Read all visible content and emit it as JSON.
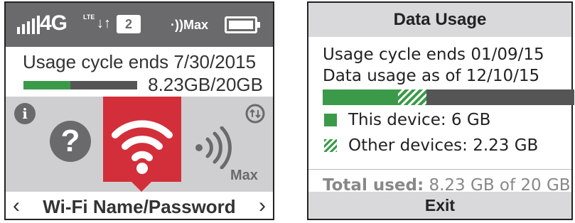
{
  "left": {
    "status": {
      "network": "4G",
      "network_sub": "LTE",
      "message_count": "2",
      "wifi_range": "Max",
      "battery_level": 1.0
    },
    "usage_cycle": "Usage cycle ends 7/30/2015",
    "usage_amount": "8.23GB/20GB",
    "usage_fraction": 0.41,
    "tiles": {
      "range_label": "Max"
    },
    "nav": {
      "title": "Wi-Fi Name/Password",
      "prev": "‹",
      "next": "›"
    }
  },
  "right": {
    "header": "Data Usage",
    "cycle_line": "Usage cycle ends 01/09/15",
    "as_of_line": "Data usage as of 12/10/15",
    "usage": {
      "this_device_gb": 6,
      "other_devices_gb": 2.23,
      "plan_gb": 20
    },
    "legend": {
      "this_device": "This device: 6 GB",
      "other_devices": "Other devices: 2.23 GB"
    },
    "total": {
      "label": "Total used:",
      "value": "8.23 GB of 20 GB"
    },
    "exit_label": "Exit"
  },
  "colors": {
    "status_bar": "#6a6a6c",
    "accent_red": "#d32f3a",
    "usage_green": "#3b9a4a",
    "bar_gray": "#555555",
    "panel_gray": "#cfcfd1"
  },
  "icons": [
    "signal-icon",
    "transfer-arrows-icon",
    "message-badge-icon",
    "wifi-range-icon",
    "battery-icon",
    "info-icon",
    "help-icon",
    "wifi-icon",
    "range-icon",
    "toggle-icon",
    "chevron-left-icon",
    "chevron-right-icon"
  ]
}
